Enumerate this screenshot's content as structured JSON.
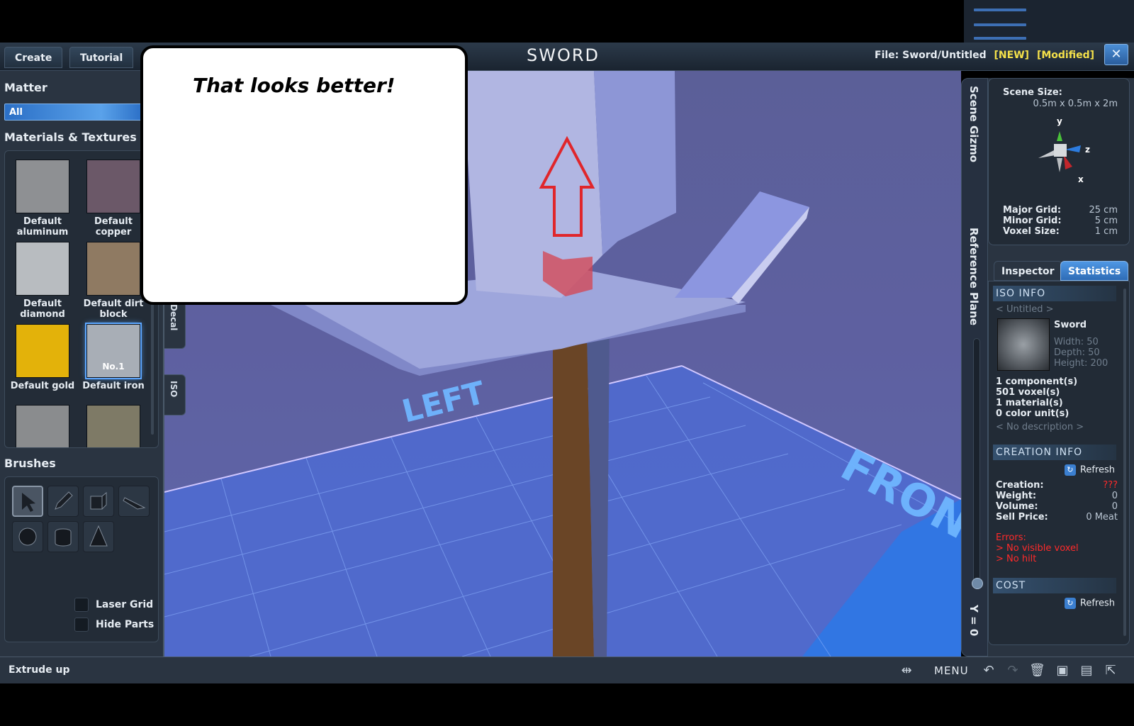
{
  "app": {
    "title": "SWORD",
    "file_label": "File:",
    "file_name": "Sword/Untitled",
    "flag_new": "[NEW]",
    "flag_modified": "[Modified]",
    "close_glyph": "✕"
  },
  "top_tabs": [
    "Create",
    "Tutorial"
  ],
  "callout": {
    "text": "That looks better!"
  },
  "left": {
    "matter_title": "Matter",
    "matter_value": "All",
    "materials_title": "Materials & Textures",
    "materials": [
      {
        "label": "Default aluminum",
        "color": "#8e9093"
      },
      {
        "label": "Default copper",
        "color": "#6b5868"
      },
      {
        "label": "Default diamond",
        "color": "#b8bcc0"
      },
      {
        "label": "Default dirt block",
        "color": "#8f7a62"
      },
      {
        "label": "Default gold",
        "color": "#e3b20a"
      },
      {
        "label": "Default iron",
        "color": "#a8aeb6",
        "tag": "No.1",
        "selected": true
      },
      {
        "label": "",
        "color": "#8a8c8e"
      },
      {
        "label": "",
        "color": "#7e7a66"
      }
    ],
    "brushes_title": "Brushes",
    "brush_icons": [
      "select-icon",
      "pencil-icon",
      "box-icon",
      "wedge-icon",
      "sphere-icon",
      "cylinder-icon",
      "cone-icon"
    ],
    "laser_grid_label": "Laser Grid",
    "hide_parts_label": "Hide Parts",
    "side_tabs": [
      "Decal",
      "ISO"
    ]
  },
  "viewport": {
    "left_label": "LEFT",
    "front_label": "FRONT",
    "colors": {
      "blade": "#a6b0e0",
      "guard": "#8f9ad8",
      "handle": "#6a4526",
      "arrow": "#e0262b",
      "grid": "#4a70d4"
    }
  },
  "rail": {
    "scene_gizmo": "Scene Gizmo",
    "reference_plane": "Reference Plane",
    "y_value": "Y = 0"
  },
  "gizmo": {
    "scene_size_label": "Scene Size:",
    "scene_size_value": "0.5m x 0.5m x 2m",
    "axis_y": "y",
    "axis_z": "z",
    "axis_x": "x",
    "major_grid_label": "Major Grid:",
    "major_grid_value": "25 cm",
    "minor_grid_label": "Minor Grid:",
    "minor_grid_value": "5 cm",
    "voxel_size_label": "Voxel Size:",
    "voxel_size_value": "1 cm"
  },
  "inspector_tabs": {
    "inspector": "Inspector",
    "statistics": "Statistics"
  },
  "iso_info": {
    "header": "ISO INFO",
    "untitled": "< Untitled >",
    "name": "Sword",
    "width": "Width: 50",
    "depth": "Depth: 50",
    "height": "Height: 200",
    "components": "1 component(s)",
    "voxels": "501 voxel(s)",
    "materials": "1 material(s)",
    "color_units": "0 color unit(s)",
    "description": "< No description >"
  },
  "creation_info": {
    "header": "CREATION INFO",
    "refresh": "Refresh",
    "creation_label": "Creation:",
    "creation_value": "???",
    "weight_label": "Weight:",
    "weight_value": "0",
    "volume_label": "Volume:",
    "volume_value": "0",
    "sell_label": "Sell Price:",
    "sell_value": "0 Meat",
    "errors_label": "Errors:",
    "error_1": "> No visible voxel",
    "error_2": "> No hilt"
  },
  "cost": {
    "header": "COST",
    "refresh": "Refresh"
  },
  "bottom": {
    "status": "Extrude up",
    "menu": "MENU",
    "icons": [
      "mirror-icon",
      "undo-icon",
      "redo-icon",
      "trash-icon",
      "save-icon",
      "save-as-icon",
      "export-icon"
    ]
  }
}
